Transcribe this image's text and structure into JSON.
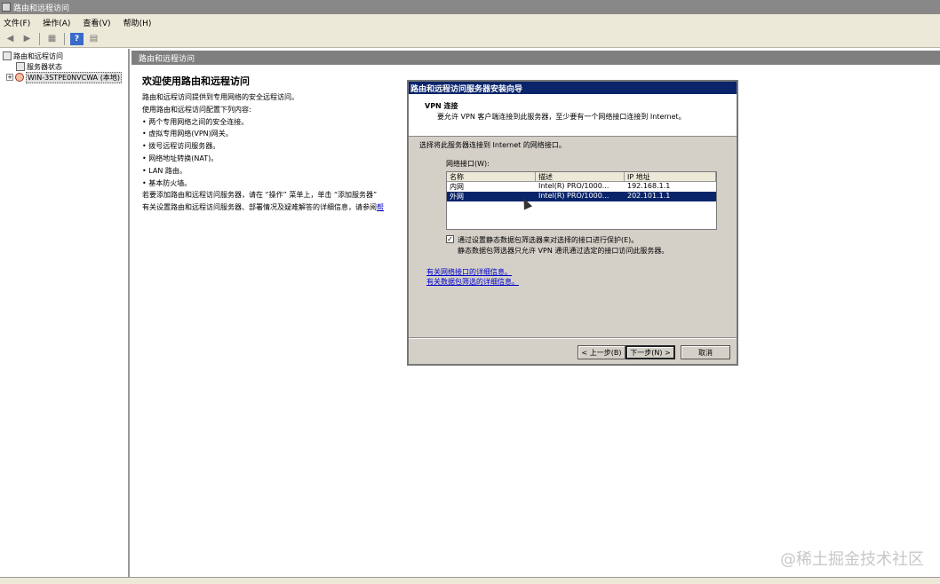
{
  "window": {
    "title": "路由和远程访问"
  },
  "menu": [
    "文件(F)",
    "操作(A)",
    "查看(V)",
    "帮助(H)"
  ],
  "tree": {
    "root": "路由和远程访问",
    "status": "服务器状态",
    "server": "WIN-3STPE0NVCWA (本地)",
    "expander": "+"
  },
  "content": {
    "header": "路由和远程访问",
    "welcome_title": "欢迎使用路由和远程访问",
    "lines": [
      "路由和远程访问提供到专用网络的安全远程访问。",
      "使用路由和远程访问配置下列内容:",
      "• 两个专用网络之间的安全连接。",
      "• 虚拟专用网络(VPN)网关。",
      "• 拨号远程访问服务器。",
      "• 网络地址转换(NAT)。",
      "• LAN 路由。",
      "• 基本防火墙。",
      "若要添加路由和远程访问服务器，请在 “操作” 菜单上，单击 “添加服务器”",
      "有关设置路由和远程访问服务器、部署情况及疑难解答的详细信息，请参阅"
    ],
    "last_link_fragment": "帮"
  },
  "wizard": {
    "title": "路由和远程访问服务器安装向导",
    "header": "VPN 连接",
    "subheader": "要允许 VPN 客户端连接到此服务器，至少要有一个网络接口连接到 Internet。",
    "prompt": "选择将此服务器连接到 Internet 的网络接口。",
    "list_label": "网络接口(W):",
    "columns": [
      "名称",
      "描述",
      "IP 地址"
    ],
    "rows": [
      {
        "name": "内网",
        "desc": "Intel(R) PRO/1000...",
        "ip": "192.168.1.1",
        "selected": false
      },
      {
        "name": "外网",
        "desc": "Intel(R) PRO/1000...",
        "ip": "202.101.1.1",
        "selected": true
      }
    ],
    "checkbox_label": "通过设置静态数据包筛选器来对选择的接口进行保护(E)。",
    "checkbox_checked": true,
    "checkbox_mark": "✓",
    "checkbox_note": "静态数据包筛选器只允许 VPN 通讯通过选定的接口访问此服务器。",
    "link1": "有关网络接口的详细信息。",
    "link2": "有关数据包筛选的详细信息。",
    "buttons": {
      "back": "< 上一步(B)",
      "next": "下一步(N) >",
      "cancel": "取消"
    }
  },
  "watermark": "@稀土掘金技术社区"
}
